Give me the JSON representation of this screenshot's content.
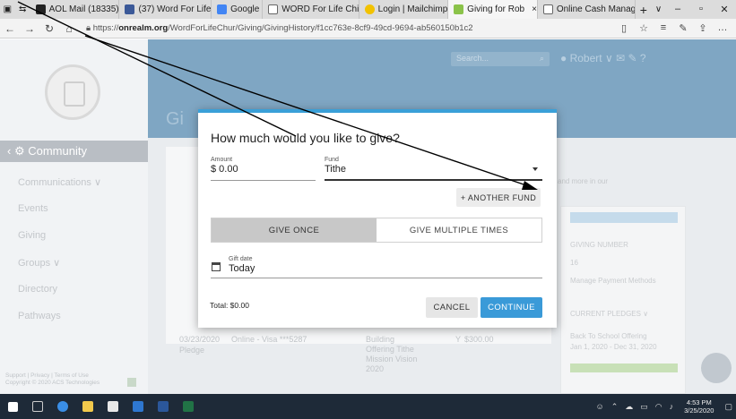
{
  "browser": {
    "tabs": [
      {
        "label": "AOL Mail (18335)",
        "icon_color": "#222222"
      },
      {
        "label": "(37) Word For Life",
        "icon_color": "#3b5998"
      },
      {
        "label": "Google",
        "icon_color": "#4285f4"
      },
      {
        "label": "WORD For Life Chi",
        "icon_color": "#666666"
      },
      {
        "label": "Login | Mailchimp",
        "icon_color": "#f2c200"
      },
      {
        "label": "Giving for Rob",
        "icon_color": "#8bc34a",
        "active": true
      },
      {
        "label": "Online Cash Manag",
        "icon_color": "#666666"
      }
    ],
    "close_tab": "×",
    "new_tab": "+",
    "url_prefix": "https://",
    "url_domain": "onrealm.org",
    "url_path": "/WordForLifeChur/Giving/GivingHistory/f1cc763e-8cf9-49cd-9694-ab560150b1c2"
  },
  "background_page": {
    "community": "Community",
    "sidebar": [
      "Communications ∨",
      "Events",
      "Giving",
      "Groups ∨",
      "Directory",
      "Pathways"
    ],
    "footer_text": "Support | Privacy | Terms of Use  Copyright © 2020 ACS Technologies",
    "search_placeholder": "Search...",
    "user_name": "Robert",
    "header_letter": "Gi",
    "note": "and more in our",
    "right_card": {
      "giving_number_label": "GIVING NUMBER",
      "giving_number": "16",
      "manage_link": "Manage Payment Methods",
      "pledges": "CURRENT PLEDGES ∨",
      "pledge_name": "Back To School Offering",
      "pledge_dates": "Jan 1, 2020 - Dec 31, 2020"
    },
    "row": {
      "date": "03/23/2020",
      "method": "Online - Visa ***5287",
      "fund": "Building Offering Tithe Mission Vision 2020",
      "amount": "$300.00",
      "amount_prefix": "Y",
      "sub": "Pledge"
    }
  },
  "modal": {
    "title": "How much would you like to give?",
    "amount_label": "Amount",
    "amount_value": "$ 0.00",
    "fund_label": "Fund",
    "fund_value": "Tithe",
    "another_fund": "+ ANOTHER FUND",
    "give_once": "GIVE ONCE",
    "give_multiple": "GIVE MULTIPLE TIMES",
    "gift_date_label": "Gift date",
    "gift_date_value": "Today",
    "total": "Total: $0.00",
    "cancel": "CANCEL",
    "continue": "CONTINUE"
  },
  "taskbar": {
    "time": "4:53 PM",
    "date": "3/25/2020"
  },
  "colors": {
    "accent": "#3aa0d8",
    "continue_bg": "#3a9ad8",
    "header_band": "#7fa6c3",
    "taskbar": "#1e2a38"
  }
}
